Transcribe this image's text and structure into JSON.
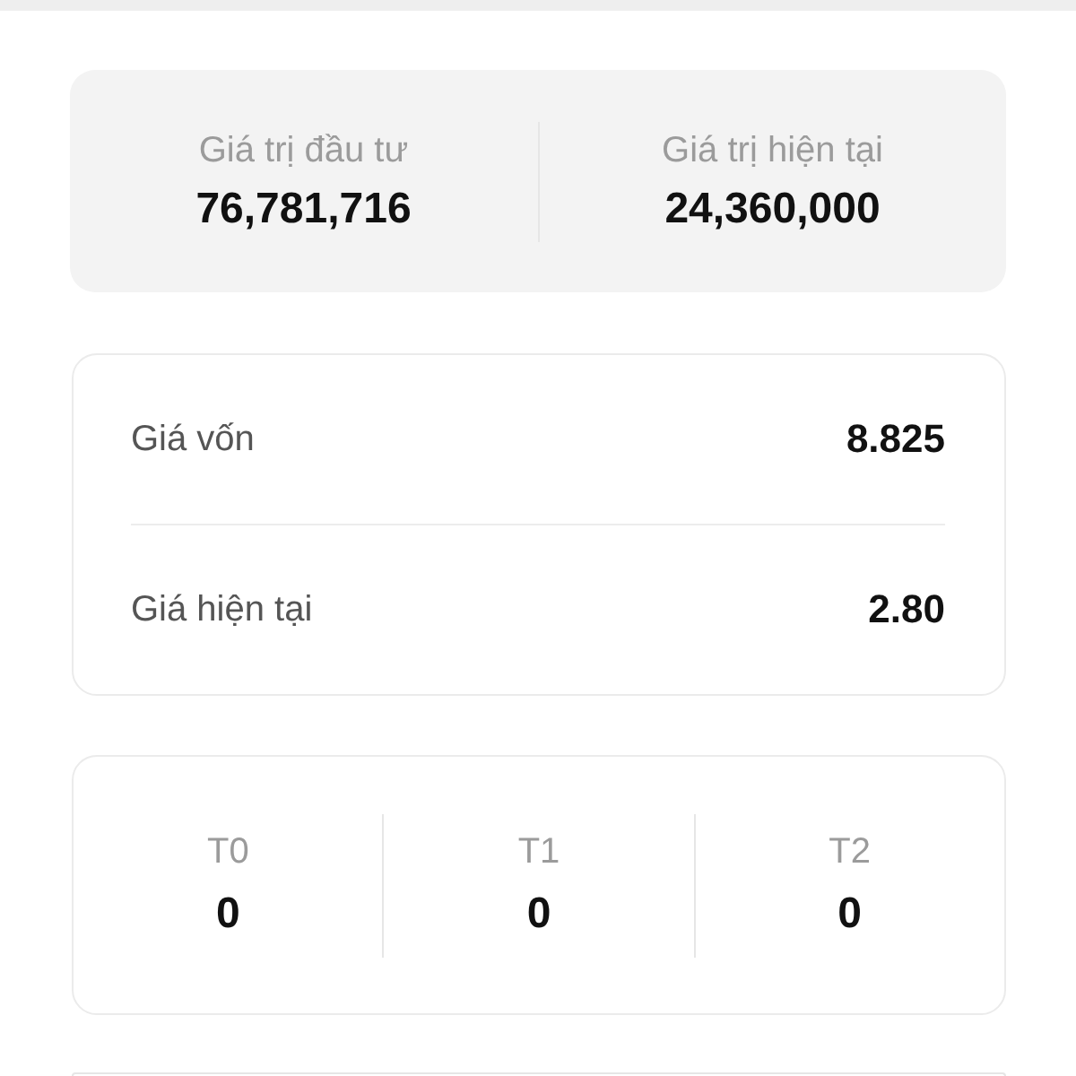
{
  "summary": {
    "items": [
      {
        "label": "Giá trị đầu tư",
        "value": "76,781,716"
      },
      {
        "label": "Giá trị hiện tại",
        "value": "24,360,000"
      }
    ]
  },
  "prices": {
    "rows": [
      {
        "label": "Giá vốn",
        "value": "8.825"
      },
      {
        "label": "Giá hiện tại",
        "value": "2.80"
      }
    ]
  },
  "settlement": {
    "columns": [
      {
        "label": "T0",
        "value": "0"
      },
      {
        "label": "T1",
        "value": "0"
      },
      {
        "label": "T2",
        "value": "0"
      }
    ]
  }
}
